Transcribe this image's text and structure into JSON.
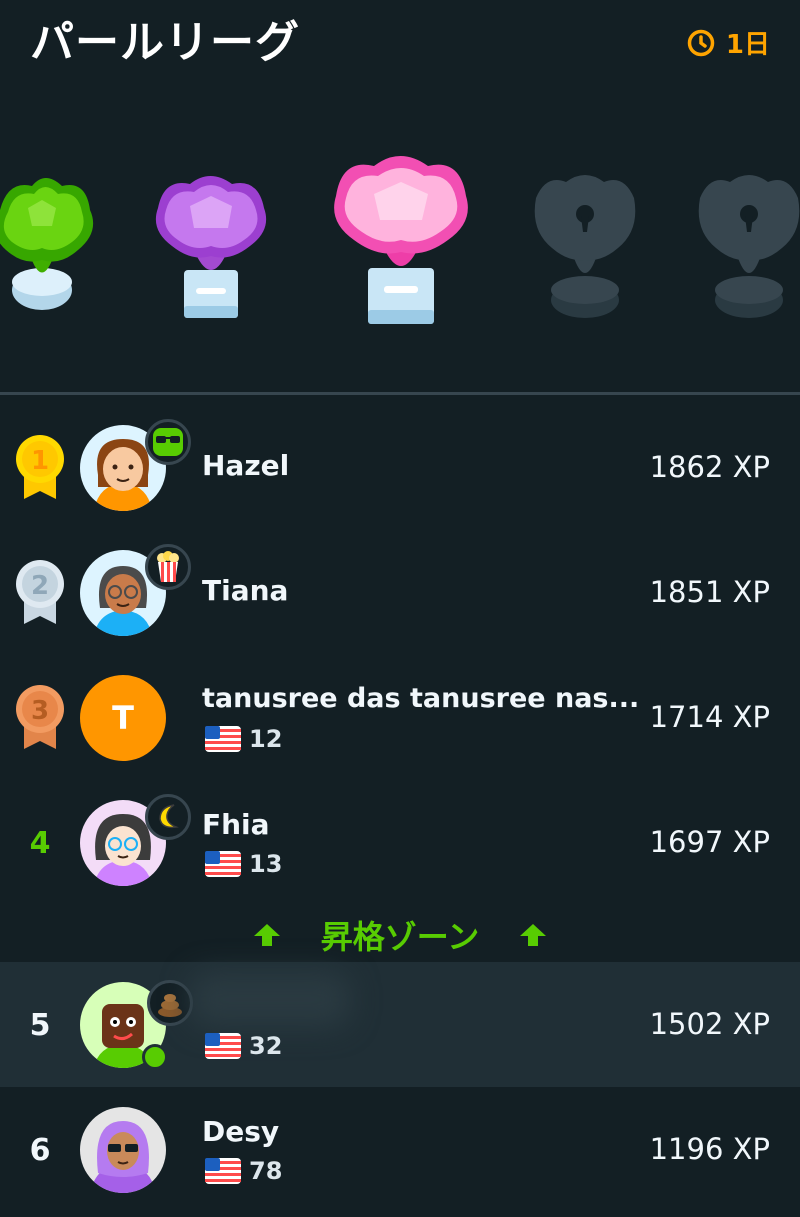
{
  "header": {
    "title": "パールリーグ",
    "time_left": "1日"
  },
  "trophies": [
    {
      "name": "emerald",
      "state": "unlocked"
    },
    {
      "name": "amethyst",
      "state": "unlocked"
    },
    {
      "name": "pearl",
      "state": "current"
    },
    {
      "name": "locked-1",
      "state": "locked"
    },
    {
      "name": "locked-2",
      "state": "locked"
    }
  ],
  "leaderboard": [
    {
      "rank": "1",
      "name": "Hazel",
      "xp": "1862 XP",
      "flag_count": ""
    },
    {
      "rank": "2",
      "name": "Tiana",
      "xp": "1851 XP",
      "flag_count": ""
    },
    {
      "rank": "3",
      "name": "tanusree das tanusree nas...",
      "xp": "1714 XP",
      "flag_count": "12",
      "avatar_letter": "T"
    },
    {
      "rank": "4",
      "name": "Fhia",
      "xp": "1697 XP",
      "flag_count": "13"
    },
    {
      "rank": "5",
      "name": "",
      "xp": "1502 XP",
      "flag_count": "32"
    },
    {
      "rank": "6",
      "name": "Desy",
      "xp": "1196 XP",
      "flag_count": "78"
    }
  ],
  "promotion_zone": {
    "label": "昇格ゾーン"
  },
  "colors": {
    "background": "#131f24",
    "accent_green": "#58cc02",
    "accent_orange": "#ffa400",
    "highlight_row": "#202f36"
  }
}
